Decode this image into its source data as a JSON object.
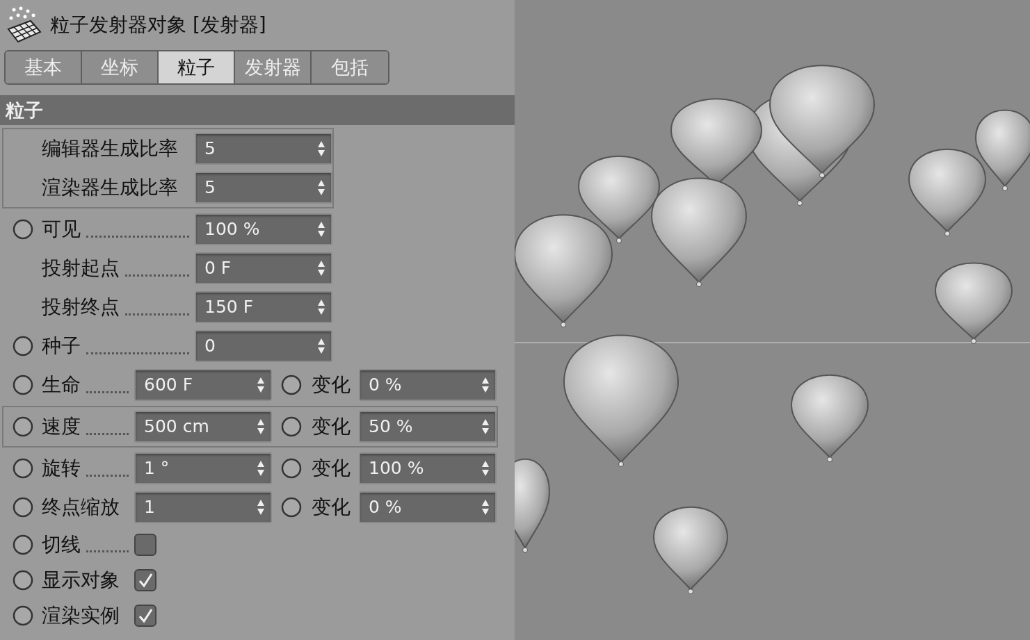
{
  "window": {
    "title": "粒子发射器对象 [发射器]"
  },
  "tabs": [
    {
      "label": "基本",
      "selected": false
    },
    {
      "label": "坐标",
      "selected": false
    },
    {
      "label": "粒子",
      "selected": true
    },
    {
      "label": "发射器",
      "selected": false
    },
    {
      "label": "包括",
      "selected": false
    }
  ],
  "section": {
    "title": "粒子"
  },
  "blocks": [
    {
      "highlighted": true,
      "rows": [
        {
          "kind": "field",
          "label": "编辑器生成比率",
          "keyframe": false,
          "leader": false,
          "value": "5"
        },
        {
          "kind": "field",
          "label": "渲染器生成比率",
          "keyframe": false,
          "leader": false,
          "value": "5"
        }
      ]
    },
    {
      "highlighted": false,
      "rows": [
        {
          "kind": "field",
          "label": "可见",
          "keyframe": true,
          "leader": true,
          "value": "100 %"
        },
        {
          "kind": "field",
          "label": "投射起点",
          "keyframe": false,
          "leader": true,
          "value": "0 F"
        },
        {
          "kind": "field",
          "label": "投射终点",
          "keyframe": false,
          "leader": true,
          "value": "150 F"
        },
        {
          "kind": "field",
          "label": "种子",
          "keyframe": true,
          "leader": true,
          "value": "0"
        },
        {
          "kind": "pair",
          "label": "生命",
          "keyframe": true,
          "leader": true,
          "value": "600 F",
          "variation_label": "变化",
          "variation": "0 %"
        }
      ]
    },
    {
      "highlighted": true,
      "rows": [
        {
          "kind": "pair",
          "label": "速度",
          "keyframe": true,
          "leader": true,
          "value": "500 cm",
          "variation_label": "变化",
          "variation": "50 %"
        }
      ]
    },
    {
      "highlighted": false,
      "rows": [
        {
          "kind": "pair",
          "label": "旋转",
          "keyframe": true,
          "leader": true,
          "value": "1 °",
          "variation_label": "变化",
          "variation": "100 %"
        },
        {
          "kind": "pair",
          "label": "终点缩放",
          "keyframe": true,
          "leader": false,
          "value": "1",
          "variation_label": "变化",
          "variation": "0 %"
        },
        {
          "kind": "checkbox",
          "label": "切线",
          "keyframe": true,
          "leader": true,
          "checked": false
        },
        {
          "kind": "checkbox",
          "label": "显示对象",
          "keyframe": true,
          "leader": false,
          "checked": true
        },
        {
          "kind": "checkbox",
          "label": "渲染实例",
          "keyframe": true,
          "leader": false,
          "checked": true
        }
      ]
    }
  ]
}
